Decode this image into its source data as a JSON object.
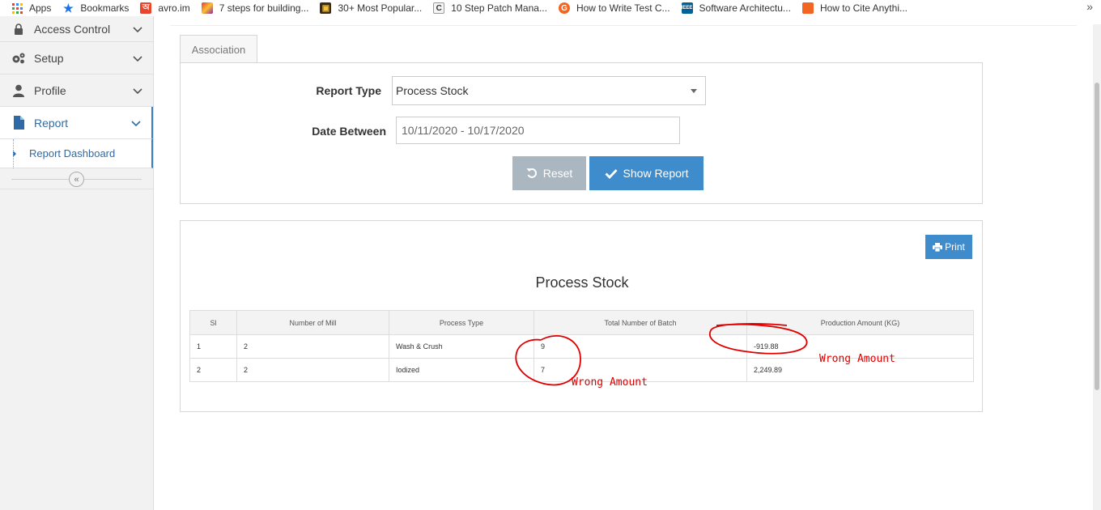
{
  "bookmarks": [
    {
      "label": "Apps",
      "icon": "apps-grid-icon"
    },
    {
      "label": "Bookmarks",
      "icon": "star-icon"
    },
    {
      "label": "avro.im",
      "icon": "avro-icon"
    },
    {
      "label": "7 steps for building...",
      "icon": "shield-colorful-icon"
    },
    {
      "label": "30+ Most Popular...",
      "icon": "cube-icon"
    },
    {
      "label": "10 Step Patch Mana...",
      "icon": "c-logo-icon"
    },
    {
      "label": "How to Write Test C...",
      "icon": "orange-circle-icon"
    },
    {
      "label": "Software Architectu...",
      "icon": "ieee-icon"
    },
    {
      "label": "How to Cite Anythi...",
      "icon": "orange-bookmark-icon"
    }
  ],
  "bookmarks_more": "»",
  "sidebar": {
    "items": [
      {
        "label": "Access Control",
        "icon": "lock-icon"
      },
      {
        "label": "Setup",
        "icon": "gears-icon"
      },
      {
        "label": "Profile",
        "icon": "user-icon"
      },
      {
        "label": "Report",
        "icon": "file-icon"
      }
    ],
    "sub_item": "Report Dashboard",
    "collapse_glyph": "«"
  },
  "tab": {
    "label": "Association"
  },
  "form": {
    "report_type_label": "Report Type",
    "report_type_value": "Process Stock",
    "date_label": "Date Between",
    "date_value": "10/11/2020 - 10/17/2020",
    "reset_label": "Reset",
    "show_label": "Show Report"
  },
  "report": {
    "print_label": "Print",
    "title": "Process Stock",
    "columns": [
      "Sl",
      "Number of Mill",
      "Process Type",
      "Total Number of Batch",
      "Production Amount (KG)"
    ],
    "rows": [
      [
        "1",
        "2",
        "Wash & Crush",
        "9",
        "-919.88"
      ],
      [
        "2",
        "2",
        "Iodized",
        "7",
        "2,249.89"
      ]
    ]
  },
  "annotations": {
    "note_1": "Wrong Amount",
    "note_2": "Wrong Amount",
    "color": "#e00000"
  },
  "colors": {
    "primary": "#3f8ccd",
    "reset": "#aab7c0",
    "link": "#2f6aa6"
  }
}
